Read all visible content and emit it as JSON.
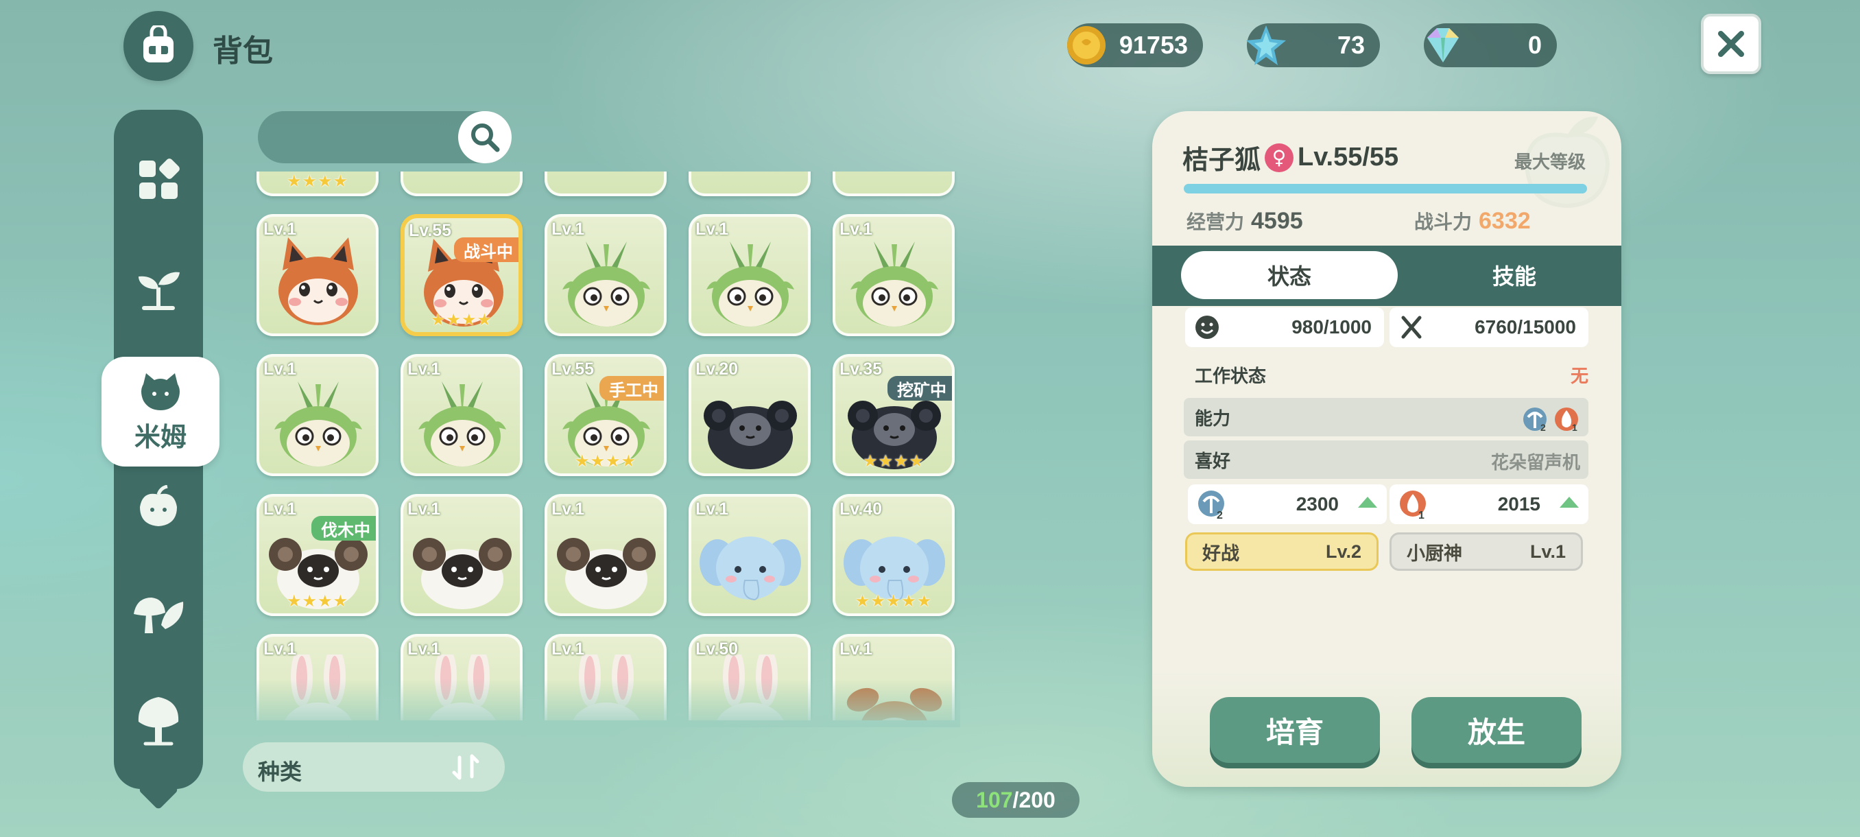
{
  "header": {
    "title": "背包",
    "icon": "backpack-icon",
    "close_icon": "close-icon"
  },
  "currencies": [
    {
      "icon": "gold-coin-icon",
      "value": "91753"
    },
    {
      "icon": "blue-star-crystal-icon",
      "value": "73"
    },
    {
      "icon": "rainbow-gem-icon",
      "value": "0"
    }
  ],
  "nav": {
    "items": [
      {
        "icon": "all-items-grid-icon",
        "label": ""
      },
      {
        "icon": "sprout-icon",
        "label": ""
      },
      {
        "icon": "mim-creature-icon",
        "label": "米姆",
        "active": true
      },
      {
        "icon": "fruit-icon",
        "label": ""
      },
      {
        "icon": "mushroom-leaf-icon",
        "label": ""
      },
      {
        "icon": "tree-icon",
        "label": ""
      }
    ]
  },
  "search": {
    "placeholder": "",
    "icon": "search-icon"
  },
  "grid": {
    "top_partial_stars": "★★★★",
    "cells": [
      {
        "species": "fox",
        "level": "Lv.1",
        "tag": "",
        "tag_type": "",
        "stars": ""
      },
      {
        "species": "fox",
        "level": "Lv.55",
        "tag": "战斗中",
        "tag_type": "battle",
        "stars": "★★★★",
        "selected": true
      },
      {
        "species": "owl",
        "level": "Lv.1",
        "tag": "",
        "tag_type": "",
        "stars": ""
      },
      {
        "species": "owl",
        "level": "Lv.1",
        "tag": "",
        "tag_type": "",
        "stars": ""
      },
      {
        "species": "owl",
        "level": "Lv.1",
        "tag": "",
        "tag_type": "",
        "stars": ""
      },
      {
        "species": "owl",
        "level": "Lv.1",
        "tag": "",
        "tag_type": "",
        "stars": ""
      },
      {
        "species": "owl",
        "level": "Lv.1",
        "tag": "",
        "tag_type": "",
        "stars": ""
      },
      {
        "species": "owl",
        "level": "Lv.55",
        "tag": "手工中",
        "tag_type": "craft",
        "stars": "★★★★"
      },
      {
        "species": "ram-dark",
        "level": "Lv.20",
        "tag": "",
        "tag_type": "",
        "stars": ""
      },
      {
        "species": "ram-dark",
        "level": "Lv.35",
        "tag": "挖矿中",
        "tag_type": "mine",
        "stars": "★★★★"
      },
      {
        "species": "ram",
        "level": "Lv.1",
        "tag": "伐木中",
        "tag_type": "log",
        "stars": "★★★★"
      },
      {
        "species": "ram",
        "level": "Lv.1",
        "tag": "",
        "tag_type": "",
        "stars": ""
      },
      {
        "species": "ram",
        "level": "Lv.1",
        "tag": "",
        "tag_type": "",
        "stars": ""
      },
      {
        "species": "elephant",
        "level": "Lv.1",
        "tag": "",
        "tag_type": "",
        "stars": ""
      },
      {
        "species": "elephant",
        "level": "Lv.40",
        "tag": "",
        "tag_type": "",
        "stars": "★★★★★"
      },
      {
        "species": "rabbit",
        "level": "Lv.1",
        "tag": "",
        "tag_type": "",
        "stars": ""
      },
      {
        "species": "rabbit",
        "level": "Lv.1",
        "tag": "",
        "tag_type": "",
        "stars": ""
      },
      {
        "species": "rabbit",
        "level": "Lv.1",
        "tag": "",
        "tag_type": "",
        "stars": ""
      },
      {
        "species": "rabbit",
        "level": "Lv.50",
        "tag": "",
        "tag_type": "",
        "stars": ""
      },
      {
        "species": "deer",
        "level": "Lv.1",
        "tag": "",
        "tag_type": "",
        "stars": ""
      }
    ]
  },
  "sort": {
    "label": "种类",
    "icon": "sort-arrows-icon"
  },
  "capacity": {
    "current": "107",
    "max": "/200"
  },
  "detail": {
    "name": "桔子狐",
    "gender_icon": "female-icon",
    "gender_symbol": "♀",
    "level": "Lv.55/55",
    "max_level_label": "最大等级",
    "exp_fraction": 1.0,
    "operation_label": "经营力",
    "operation_value": "4595",
    "combat_label": "战斗力",
    "combat_value": "6332",
    "tabs": {
      "status": "状态",
      "skills": "技能"
    },
    "mood": {
      "icon": "smile-face-icon",
      "value": "980/1000"
    },
    "satiety": {
      "icon": "fork-knife-icon",
      "value": "6760/15000"
    },
    "work_status_label": "工作状态",
    "work_status_value": "无",
    "ability_label": "能力",
    "ability_badges": [
      {
        "icon": "mining-pickaxe-icon",
        "level": "2"
      },
      {
        "icon": "fire-icon",
        "level": "1"
      }
    ],
    "preference_label": "喜好",
    "preference_value": "花朵留声机",
    "skill_values": [
      {
        "icon": "mining-pickaxe-icon",
        "level": "2",
        "value": "2300",
        "trend_icon": "up-arrow-icon"
      },
      {
        "icon": "fire-icon",
        "level": "1",
        "value": "2015",
        "trend_icon": "up-arrow-icon"
      }
    ],
    "traits": [
      {
        "name": "好战",
        "level": "Lv.2",
        "style": "gold"
      },
      {
        "name": "小厨神",
        "level": "Lv.1",
        "style": "grey"
      }
    ],
    "buttons": {
      "train": "培育",
      "release": "放生"
    }
  },
  "colors": {
    "accent_dark_teal": "#3f6d66",
    "button_green": "#5c9a84",
    "combat_orange": "#f2a86a",
    "selected_border": "#f5cd4a",
    "exp_bar": "#7ed1e2"
  }
}
